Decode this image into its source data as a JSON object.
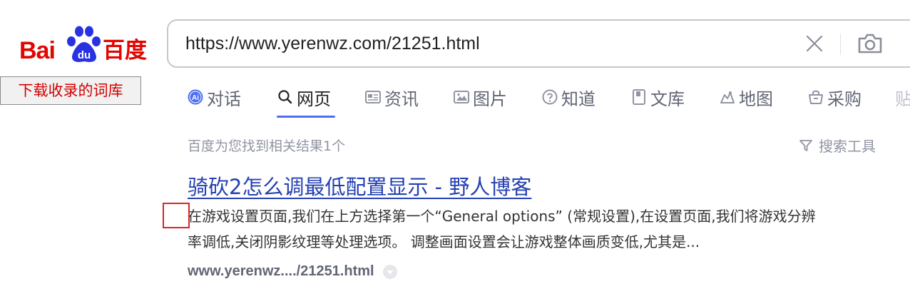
{
  "logo": {
    "latin": "Bai",
    "paw_text": "du",
    "cn": "百度",
    "brand_red": "#e10601",
    "brand_blue": "#2932e1"
  },
  "download_button": {
    "label": "下载收录的词库"
  },
  "search": {
    "value": "https://www.yerenwz.com/21251.html",
    "clear_icon": "close-icon",
    "camera_icon": "camera-icon"
  },
  "tabs": [
    {
      "label": "对话",
      "icon": "ai-chat-icon"
    },
    {
      "label": "网页",
      "icon": "search-icon",
      "active": true
    },
    {
      "label": "资讯",
      "icon": "news-icon"
    },
    {
      "label": "图片",
      "icon": "image-icon"
    },
    {
      "label": "知道",
      "icon": "question-icon"
    },
    {
      "label": "文库",
      "icon": "document-icon"
    },
    {
      "label": "地图",
      "icon": "map-icon"
    },
    {
      "label": "采购",
      "icon": "shopping-basket-icon"
    },
    {
      "label": "贴",
      "icon": ""
    }
  ],
  "results_meta": {
    "count_text": "百度为您找到相关结果1个",
    "tools_label": "搜索工具"
  },
  "result": {
    "title": "骑砍2怎么调最低配置显示 - 野人博客",
    "snippet_line1": "在游戏设置页面,我们在上方选择第一个“General options” (常规设置),在设置页面,我们将游戏分辨",
    "snippet_line2": "率调低,关闭阴影纹理等处理选项。 调整画面设置会让游戏整体画质变低,尤其是...",
    "url": "www.yerenwz..../21251.html"
  },
  "colors": {
    "accent": "#4e6ef2",
    "link": "#2440b3",
    "highlight": "#d6262a"
  }
}
